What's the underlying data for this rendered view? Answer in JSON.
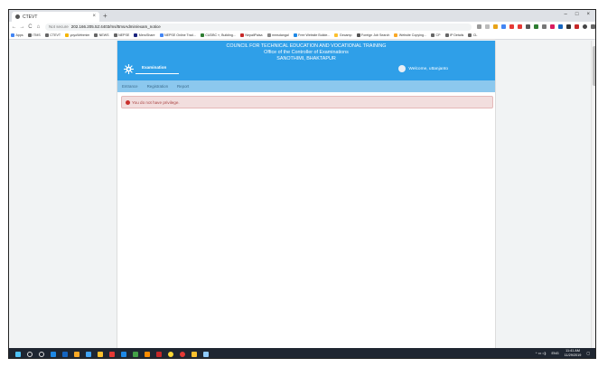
{
  "browser": {
    "tab_title": "CTEVT",
    "new_tab_symbol": "+",
    "window_controls": [
      "–",
      "□",
      "×"
    ],
    "nav_buttons": [
      "←",
      "→",
      "C",
      "⌂"
    ],
    "security_label": "Not secure",
    "url": "202.166.205.52:4403/ms/ttmsAdmin/exam_notice",
    "bookmarks": [
      "Apps",
      "ITMS",
      "CTEVT",
      "yoyoWebmim",
      "NEWS",
      "NEPSE",
      "MeroShare",
      "NEPSE Online Trad...",
      "CUDBC », Building...",
      "NepaliPaisa",
      "mmsdangal",
      "Free Website Builde...",
      "Gecamp",
      "Foreign Job Search",
      "Website Copying...",
      "CP",
      "IP Details",
      "CL"
    ]
  },
  "site": {
    "header_line1": "COUNCIL FOR TECHNICAL EDUCATION AND VOCATIONAL TRAINING",
    "header_line2": "Office of the Controller of Examinations",
    "header_line3": "SANOTHIMI, BHAKTAPUR",
    "main_nav": "Examination",
    "welcome": "Welcome, uttanjanto",
    "sub_nav": [
      "Entrance",
      "Registration",
      "Report"
    ],
    "alert_text": "You do not have privilege."
  },
  "taskbar": {
    "time": "11:41 AM",
    "date": "11/29/2019",
    "lang": "ENG"
  },
  "colors": {
    "header_blue": "#2f9fe8",
    "subnav_blue": "#8cc8ee",
    "alert_bg": "#f2dede",
    "alert_text": "#a94442",
    "taskbar": "#1f2631"
  }
}
